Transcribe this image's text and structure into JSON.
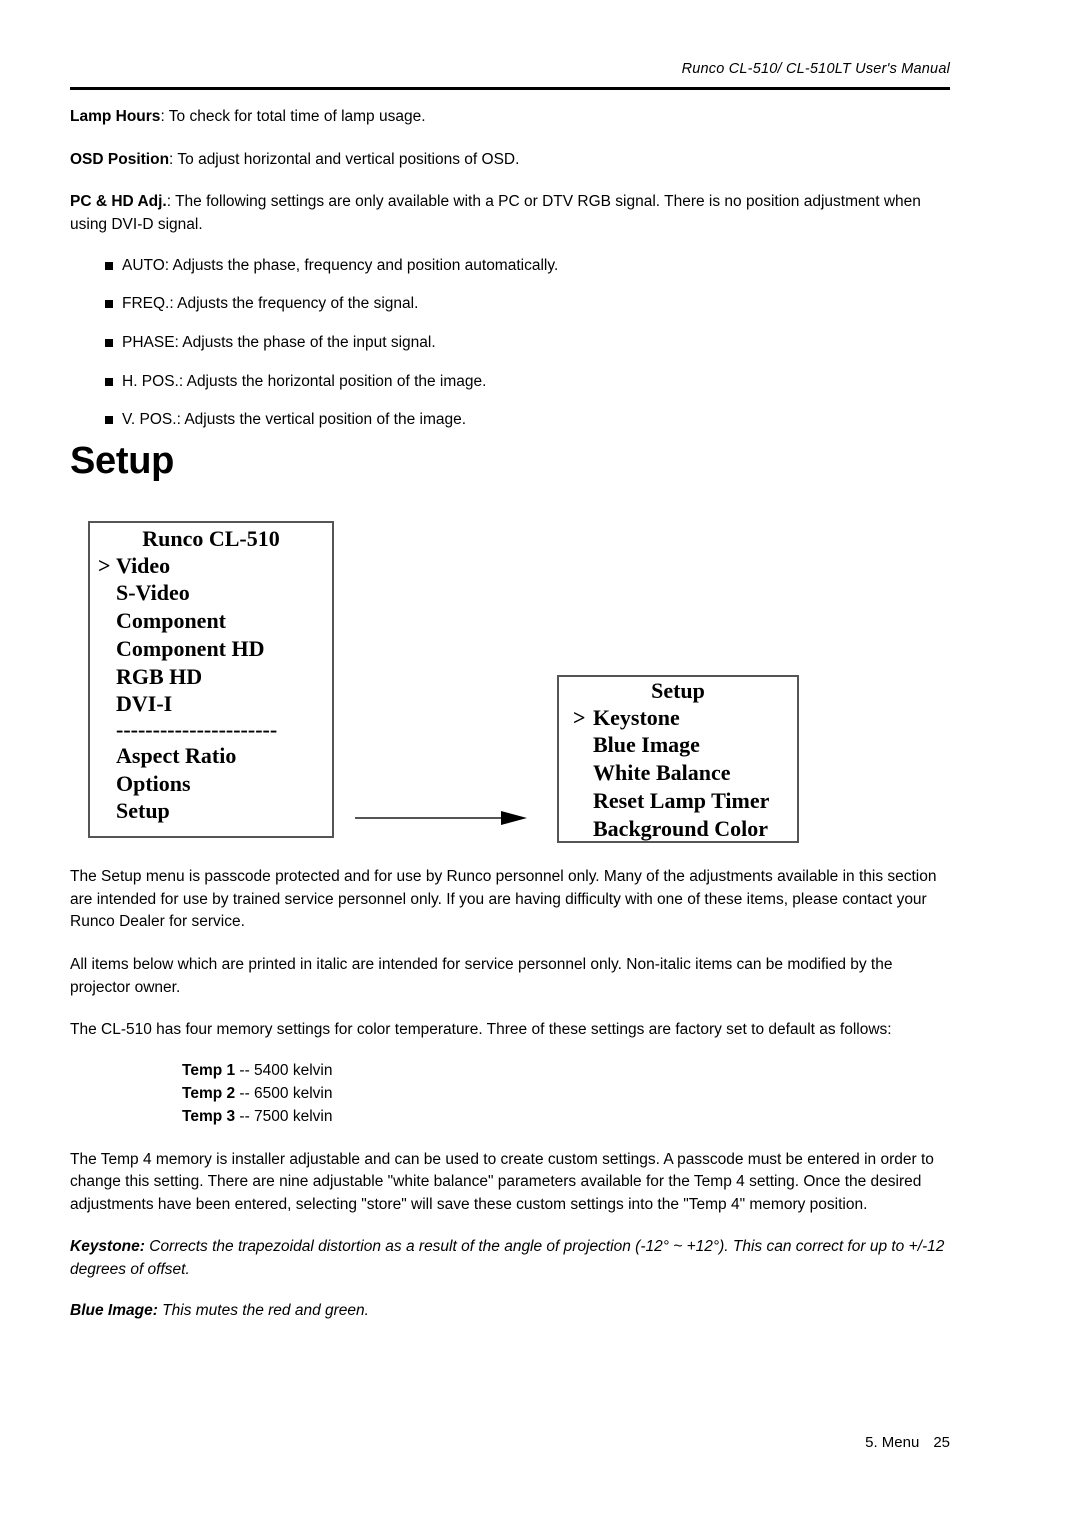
{
  "header": {
    "manual_title": "Runco CL-510/ CL-510LT User's Manual"
  },
  "definitions": [
    {
      "term": "Lamp Hours",
      "separator": ": ",
      "text": "To check for total time of lamp usage."
    },
    {
      "term": "OSD Position",
      "separator": ": ",
      "text": "To adjust horizontal and vertical positions of OSD."
    },
    {
      "term": "PC & HD Adj.",
      "separator": ": ",
      "text": "The following settings are only available with a PC or DTV RGB signal. There is no position adjustment when using DVI-D signal."
    }
  ],
  "bullets": [
    "AUTO: Adjusts the phase, frequency and position automatically.",
    "FREQ.: Adjusts the frequency of the signal.",
    "PHASE: Adjusts the phase of the input signal.",
    "H. POS.: Adjusts the horizontal position of the image.",
    "V. POS.: Adjusts the vertical position of the image."
  ],
  "section": {
    "heading": "Setup"
  },
  "osd_diagram": {
    "left_menu": {
      "title": "Runco CL-510",
      "selected_marker": ">",
      "items_top": [
        "Video",
        "S-Video",
        "Component",
        "Component HD",
        "RGB HD",
        "DVI-I"
      ],
      "divider": "----------------------",
      "items_bottom": [
        "Aspect Ratio",
        "Options",
        "Setup"
      ],
      "selected_item": "Video"
    },
    "right_menu": {
      "title": "Setup",
      "selected_marker": ">",
      "items": [
        "Keystone",
        "Blue Image",
        "White Balance",
        "Reset Lamp Timer",
        "Background Color"
      ],
      "selected_item": "Keystone"
    },
    "arrow_label": "leads-to-arrow"
  },
  "paragraphs": {
    "setup_protected": "The Setup menu is passcode protected and for use by Runco personnel only. Many of the adjustments available in this section are intended for use by trained service personnel only. If you are having difficulty with one of these items, please contact your Runco Dealer for service.",
    "italic_notice": "All items below which are printed in italic are intended for service personnel only. Non-italic items can be modified by the projector owner.",
    "memory_intro": "The CL-510 has four memory settings for color temperature. Three of these settings are factory set to default as follows:",
    "temp4_note": "The Temp 4 memory is installer adjustable and can be used to create custom settings. A passcode must be entered in order to change this setting. There are nine adjustable \"white balance\" parameters available for the Temp 4 setting. Once the desired adjustments have been entered, selecting \"store\" will save these custom settings into the \"Temp 4\" memory position."
  },
  "temperature_presets": [
    {
      "label": "Temp 1",
      "value": " -- 5400 kelvin"
    },
    {
      "label": "Temp 2",
      "value": " -- 6500 kelvin"
    },
    {
      "label": "Temp 3",
      "value": " -- 7500 kelvin"
    }
  ],
  "service_items": [
    {
      "term": "Keystone:",
      "text": " Corrects the trapezoidal distortion as a result of the angle of projection (-12° ~ +12°). This can correct for up to +/-12 degrees of offset."
    },
    {
      "term": "Blue Image:",
      "text": " This mutes the red and green."
    }
  ],
  "footer": {
    "chapter": "5. Menu",
    "page_number": "25"
  }
}
